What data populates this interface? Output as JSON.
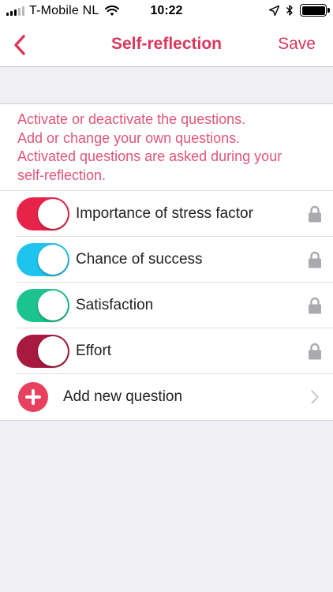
{
  "status_bar": {
    "carrier": "T-Mobile NL",
    "time": "10:22",
    "icons": [
      "signal-icon",
      "wifi-icon",
      "location-arrow-icon",
      "bluetooth-icon",
      "battery-icon"
    ]
  },
  "nav": {
    "back_icon": "chevron-left-icon",
    "title": "Self-reflection",
    "save_label": "Save"
  },
  "info": {
    "lines": [
      "Activate or deactivate the questions.",
      "Add or change your own questions.",
      "Activated questions are asked during your",
      "self-reflection."
    ]
  },
  "questions": [
    {
      "label": "Importance of stress factor",
      "active": true,
      "color": "#e8234a",
      "icon": "lock-icon"
    },
    {
      "label": "Chance of success",
      "active": true,
      "color": "#1fc4ee",
      "icon": "lock-icon"
    },
    {
      "label": "Satisfaction",
      "active": true,
      "color": "#1cc38f",
      "icon": "lock-icon"
    },
    {
      "label": "Effort",
      "active": true,
      "color": "#a8193f",
      "icon": "lock-icon"
    }
  ],
  "add_question": {
    "label": "Add new question",
    "icon": "plus-circle-icon",
    "chevron": "chevron-right-icon"
  },
  "colors": {
    "accent": "#d9375c",
    "info_text": "#e0557a",
    "add_button": "#e8415f"
  }
}
